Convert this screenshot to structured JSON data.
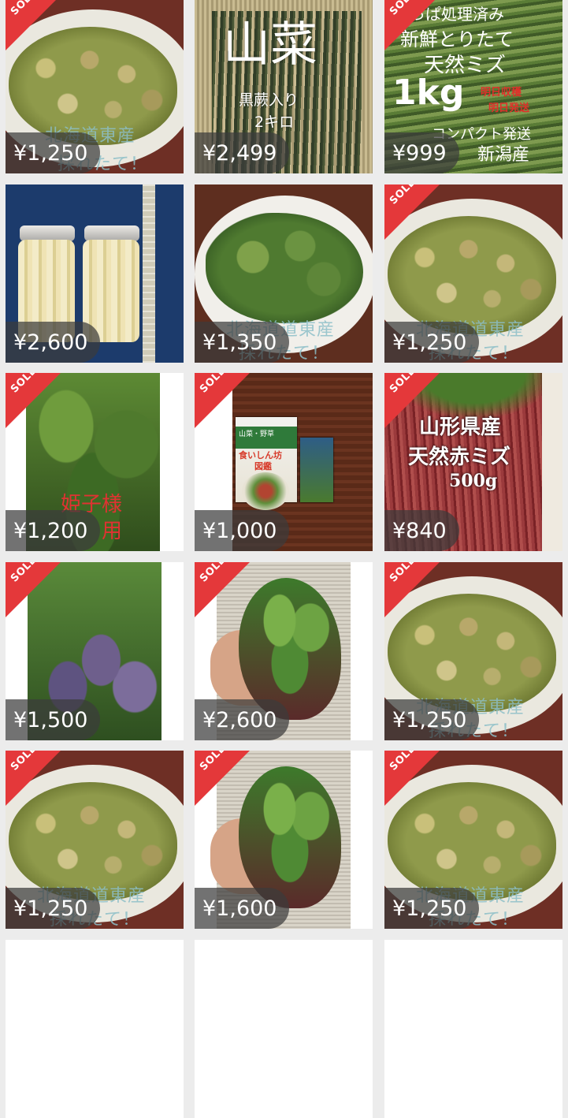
{
  "badge": {
    "sold": "SOLD"
  },
  "items": [
    {
      "price": "¥1,250",
      "sold": true,
      "overlay": [
        "北海道東産",
        "採れたて！"
      ]
    },
    {
      "price": "¥2,499",
      "sold": false,
      "title": "山菜",
      "sub": [
        "黒蕨入り",
        "2キロ"
      ]
    },
    {
      "price": "¥999",
      "sold": true,
      "lines": [
        "っぱ処理済み",
        "新鮮とりたて",
        "天然ミズ",
        "1kg"
      ],
      "red": [
        "明日収穫",
        "明日発送"
      ],
      "bottom": [
        "コンパクト発送",
        "新潟産"
      ]
    },
    {
      "price": "¥2,600",
      "sold": false
    },
    {
      "price": "¥1,350",
      "sold": false,
      "overlay": [
        "北海道道東産",
        "採れたて！"
      ]
    },
    {
      "price": "¥1,250",
      "sold": true,
      "overlay": [
        "北海道道東産",
        "採れたて！"
      ]
    },
    {
      "price": "¥1,200",
      "sold": true,
      "red": [
        "姫子様",
        "用"
      ]
    },
    {
      "price": "¥1,000",
      "sold": true,
      "book": [
        "山菜・野草",
        "食いしん坊",
        "図鑑"
      ]
    },
    {
      "price": "¥840",
      "sold": true,
      "lines": [
        "山形県産",
        "天然赤ミズ",
        "500g"
      ]
    },
    {
      "price": "¥1,500",
      "sold": true
    },
    {
      "price": "¥2,600",
      "sold": true
    },
    {
      "price": "¥1,250",
      "sold": true,
      "overlay": [
        "北海道道東産",
        "採れたて！"
      ]
    },
    {
      "price": "¥1,250",
      "sold": true,
      "overlay": [
        "北海道道東産",
        "採れたて！"
      ]
    },
    {
      "price": "¥1,600",
      "sold": true
    },
    {
      "price": "¥1,250",
      "sold": true,
      "overlay": [
        "北海道道東産",
        "採れたて！"
      ]
    }
  ]
}
